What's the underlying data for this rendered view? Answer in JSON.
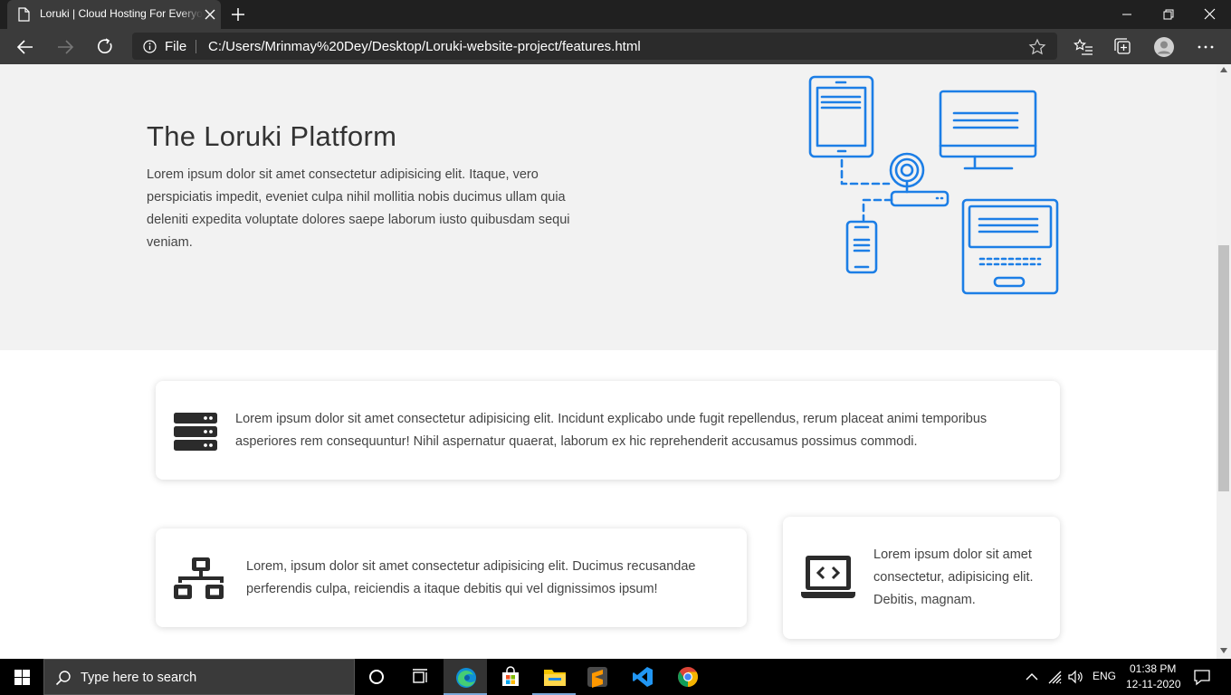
{
  "browser": {
    "tab_title": "Loruki | Cloud Hosting For Everyone",
    "address_scheme": "File",
    "url": "C:/Users/Mrinmay%20Dey/Desktop/Loruki-website-project/features.html"
  },
  "hero": {
    "title": "The Loruki Platform",
    "text": "Lorem ipsum dolor sit amet consectetur adipisicing elit. Itaque, vero perspiciatis impedit, eveniet culpa nihil mollitia nobis ducimus ullam quia deleniti expedita voluptate dolores saepe laborum iusto quibusdam sequi veniam.",
    "illustration_icon": "network-devices-illustration"
  },
  "features": [
    {
      "icon": "server-icon",
      "text": "Lorem ipsum dolor sit amet consectetur adipisicing elit. Incidunt explicabo unde fugit repellendus, rerum placeat animi temporibus asperiores rem consequuntur! Nihil aspernatur quaerat, laborum ex hic reprehenderit accusamus possimus commodi."
    },
    {
      "icon": "network-wired-icon",
      "text": "Lorem, ipsum dolor sit amet consectetur adipisicing elit. Ducimus recusandae perferendis culpa, reiciendis a itaque debitis qui vel dignissimos ipsum!"
    },
    {
      "icon": "laptop-code-icon",
      "text": "Lorem ipsum dolor sit amet consectetur, adipisicing elit. Debitis, magnam."
    }
  ],
  "taskbar": {
    "search_placeholder": "Type here to search",
    "language": "ENG",
    "time": "01:38 PM",
    "date": "12-11-2020"
  },
  "colors": {
    "illustration_blue": "#1c7ee6",
    "icon_dark": "#2b2b2b",
    "hero_bg": "#f2f2f2"
  }
}
